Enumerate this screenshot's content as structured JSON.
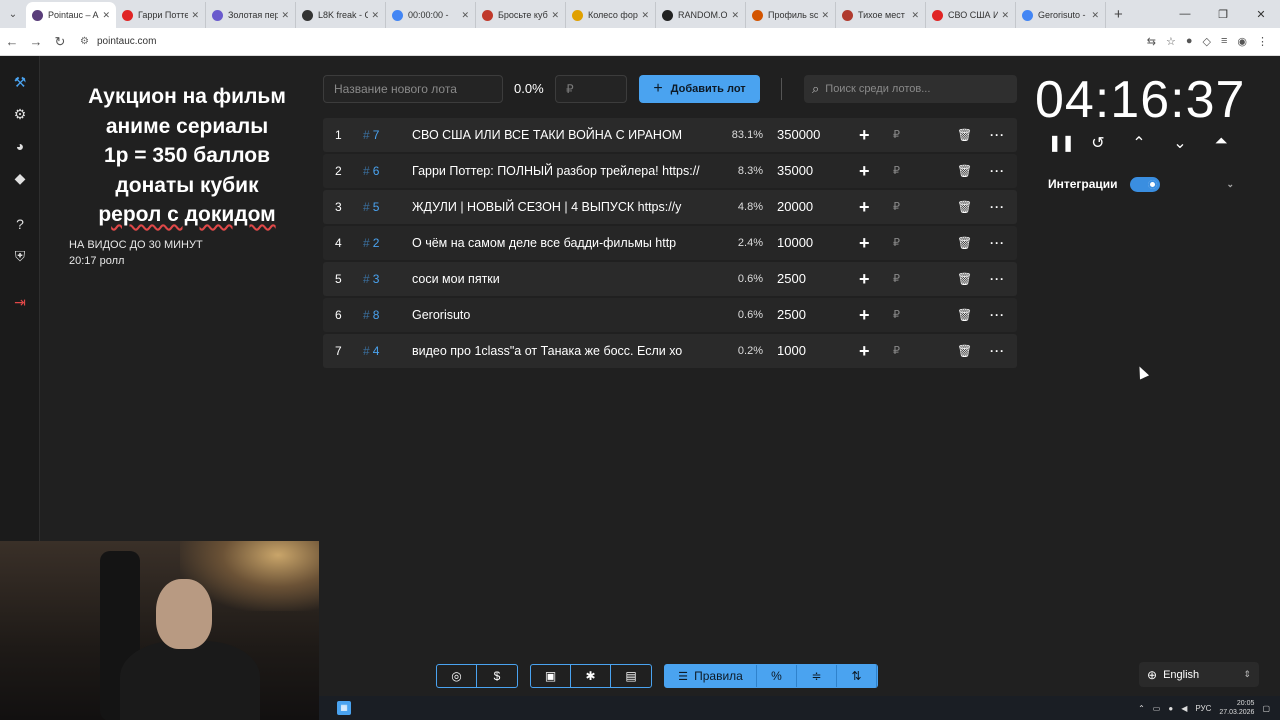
{
  "browser": {
    "tabs": [
      {
        "label": "Pointauc – A",
        "color": "#5a3e7a",
        "active": true
      },
      {
        "label": "Гарри Потте",
        "color": "#e02424",
        "active": false
      },
      {
        "label": "Золотая пер",
        "color": "#6a5acd",
        "active": false
      },
      {
        "label": "L8K freak - C",
        "color": "#333333",
        "active": false
      },
      {
        "label": "00:00:00 -",
        "color": "#4285f4",
        "active": false
      },
      {
        "label": "Бросьте куб",
        "color": "#c0392b",
        "active": false
      },
      {
        "label": "Колесо фор",
        "color": "#e0a000",
        "active": false
      },
      {
        "label": "RANDOM.O",
        "color": "#222222",
        "active": false
      },
      {
        "label": "Профиль sc",
        "color": "#d35400",
        "active": false
      },
      {
        "label": "Тихое мест",
        "color": "#b03a2e",
        "active": false
      },
      {
        "label": "СВО США И",
        "color": "#e02424",
        "active": false
      },
      {
        "label": "Gerorisuto -",
        "color": "#4285f4",
        "active": false
      }
    ],
    "url": "pointauc.com"
  },
  "heading": {
    "line1": "Аукцион на фильм",
    "line2": "аниме сериалы",
    "line3": "1р = 350 баллов",
    "line4": "донаты кубик",
    "line5": "ерол с докидом"
  },
  "note": {
    "line1": "НА ВИДОС ДО 30 МИНУТ",
    "line2": "20:17 ролл"
  },
  "controls": {
    "new_lot_placeholder": "Название нового лота",
    "percent": "0.0%",
    "currency_placeholder": "₽",
    "add_lot_label": "Добавить лот",
    "search_placeholder": "Поиск среди лотов..."
  },
  "lots": [
    {
      "index": "1",
      "id": "7",
      "name": "СВО США ИЛИ ВСЕ ТАКИ ВОЙНА С ИРАНОМ",
      "percent": "83.1%",
      "amount": "350000"
    },
    {
      "index": "2",
      "id": "6",
      "name": "Гарри Поттер: ПОЛНЫЙ разбор трейлера! https://",
      "percent": "8.3%",
      "amount": "35000"
    },
    {
      "index": "3",
      "id": "5",
      "name": "ЖДУЛИ | НОВЫЙ СЕЗОН | 4 ВЫПУСК https://y",
      "percent": "4.8%",
      "amount": "20000"
    },
    {
      "index": "4",
      "id": "2",
      "name": " О чём на самом деле все бадди-фильмы http",
      "percent": "2.4%",
      "amount": "10000"
    },
    {
      "index": "5",
      "id": "3",
      "name": "соси мои пятки",
      "percent": "0.6%",
      "amount": "2500"
    },
    {
      "index": "6",
      "id": "8",
      "name": "Gerorisuto",
      "percent": "0.6%",
      "amount": "2500"
    },
    {
      "index": "7",
      "id": "4",
      "name": "видео про 1class\"a от Танака же босс. Если хо",
      "percent": "0.2%",
      "amount": "1000"
    }
  ],
  "lot_currency": "₽",
  "timer": {
    "value": "04:16:37"
  },
  "integrations": {
    "label": "Интеграции",
    "enabled": true
  },
  "bottom": {
    "rules_label": "Правила"
  },
  "language": {
    "value": "English"
  },
  "taskbar": {
    "lang": "РУС",
    "time": "20:05",
    "date": "27.03.2026"
  }
}
